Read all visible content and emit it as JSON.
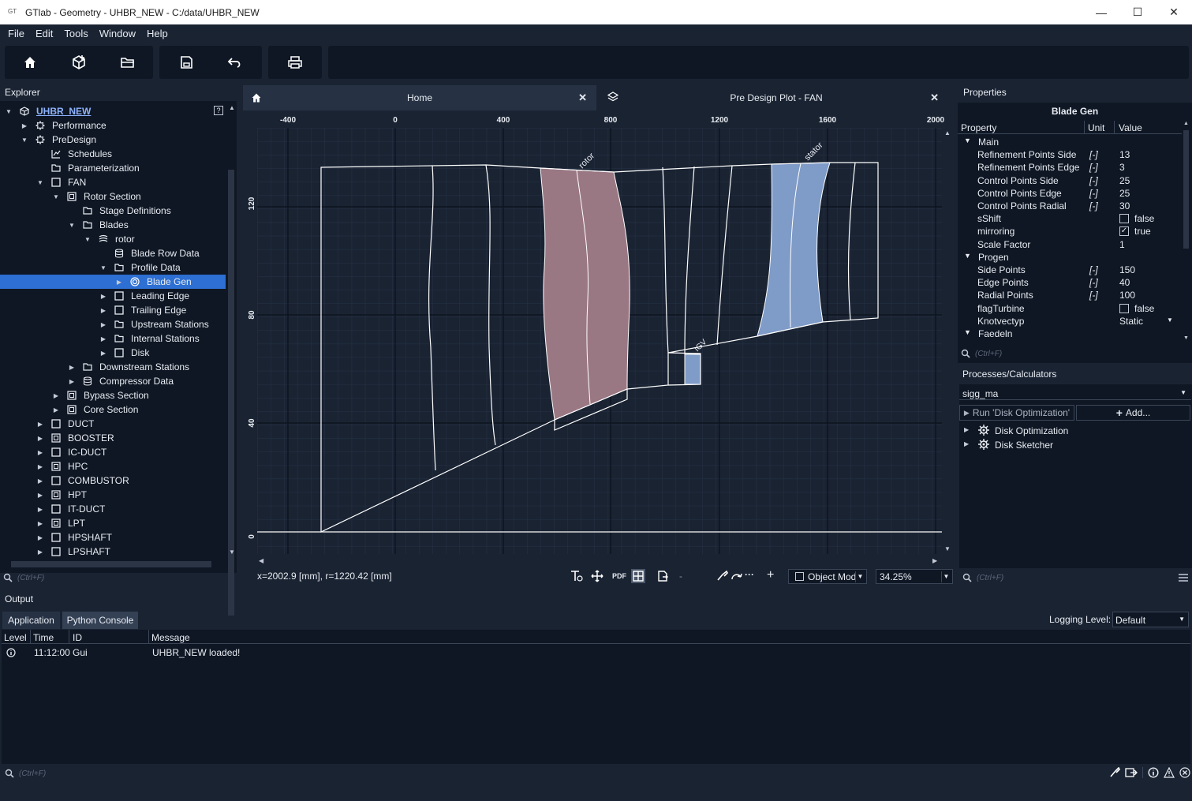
{
  "window": {
    "title": "GTlab - Geometry - UHBR_NEW - C:/data/UHBR_NEW",
    "app_icon": "GT",
    "minimize": "—",
    "maximize": "☐",
    "close": "✕"
  },
  "menu": [
    "File",
    "Edit",
    "Tools",
    "Window",
    "Help"
  ],
  "toolbar": {
    "buttons": [
      "home-icon",
      "new-project-icon",
      "open-folder-icon",
      "save-icon",
      "undo-icon",
      "print-icon"
    ]
  },
  "explorer": {
    "title": "Explorer",
    "help": "?",
    "search_placeholder": "(Ctrl+F)",
    "items": [
      {
        "label": "UHBR_NEW",
        "depth": 0,
        "arrow": "open",
        "icon": "project-icon",
        "highlight": true
      },
      {
        "label": "Performance",
        "depth": 1,
        "arrow": "closed",
        "icon": "gear-icon"
      },
      {
        "label": "PreDesign",
        "depth": 1,
        "arrow": "open",
        "icon": "gear-icon"
      },
      {
        "label": "Schedules",
        "depth": 2,
        "arrow": "none",
        "icon": "chart-icon"
      },
      {
        "label": "Parameterization",
        "depth": 2,
        "arrow": "none",
        "icon": "folder-icon"
      },
      {
        "label": "FAN",
        "depth": 2,
        "arrow": "open",
        "icon": "box-icon"
      },
      {
        "label": "Rotor Section",
        "depth": 3,
        "arrow": "open",
        "icon": "section-icon"
      },
      {
        "label": "Stage Definitions",
        "depth": 4,
        "arrow": "none",
        "icon": "folder-icon"
      },
      {
        "label": "Blades",
        "depth": 4,
        "arrow": "open",
        "icon": "folder-icon"
      },
      {
        "label": "rotor",
        "depth": 5,
        "arrow": "open",
        "icon": "blade-icon"
      },
      {
        "label": "Blade Row Data",
        "depth": 6,
        "arrow": "none",
        "icon": "database-icon"
      },
      {
        "label": "Profile Data",
        "depth": 6,
        "arrow": "open",
        "icon": "folder-icon"
      },
      {
        "label": "Blade Gen",
        "depth": 7,
        "arrow": "closed",
        "icon": "target-icon",
        "selected": true
      },
      {
        "label": "Leading Edge",
        "depth": 6,
        "arrow": "closed",
        "icon": "box-icon"
      },
      {
        "label": "Trailing Edge",
        "depth": 6,
        "arrow": "closed",
        "icon": "box-icon"
      },
      {
        "label": "Upstream Stations",
        "depth": 6,
        "arrow": "closed",
        "icon": "folder-icon"
      },
      {
        "label": "Internal Stations",
        "depth": 6,
        "arrow": "closed",
        "icon": "folder-icon"
      },
      {
        "label": "Disk",
        "depth": 6,
        "arrow": "closed",
        "icon": "box-icon"
      },
      {
        "label": "Downstream Stations",
        "depth": 4,
        "arrow": "closed",
        "icon": "folder-icon"
      },
      {
        "label": "Compressor Data",
        "depth": 4,
        "arrow": "closed",
        "icon": "database-icon"
      },
      {
        "label": "Bypass Section",
        "depth": 3,
        "arrow": "closed",
        "icon": "section-icon"
      },
      {
        "label": "Core Section",
        "depth": 3,
        "arrow": "closed",
        "icon": "section-icon"
      },
      {
        "label": "DUCT",
        "depth": 2,
        "arrow": "closed",
        "icon": "box-icon"
      },
      {
        "label": "BOOSTER",
        "depth": 2,
        "arrow": "closed",
        "icon": "section-icon"
      },
      {
        "label": "IC-DUCT",
        "depth": 2,
        "arrow": "closed",
        "icon": "box-icon"
      },
      {
        "label": "HPC",
        "depth": 2,
        "arrow": "closed",
        "icon": "section-icon"
      },
      {
        "label": "COMBUSTOR",
        "depth": 2,
        "arrow": "closed",
        "icon": "box-icon"
      },
      {
        "label": "HPT",
        "depth": 2,
        "arrow": "closed",
        "icon": "section-icon"
      },
      {
        "label": "IT-DUCT",
        "depth": 2,
        "arrow": "closed",
        "icon": "box-icon"
      },
      {
        "label": "LPT",
        "depth": 2,
        "arrow": "closed",
        "icon": "section-icon"
      },
      {
        "label": "HPSHAFT",
        "depth": 2,
        "arrow": "closed",
        "icon": "box-icon"
      },
      {
        "label": "LPSHAFT",
        "depth": 2,
        "arrow": "closed",
        "icon": "box-icon"
      }
    ]
  },
  "tabs": [
    {
      "label": "Home",
      "icon": "home-icon",
      "close": "✕"
    },
    {
      "label": "Pre Design Plot - FAN",
      "icon": "layers-icon",
      "close": "✕",
      "active": true
    }
  ],
  "plot": {
    "x_ticks": [
      "-400",
      "0",
      "400",
      "800",
      "1200",
      "1600",
      "2000"
    ],
    "y_ticks": [
      "120",
      "80",
      "40",
      "0"
    ],
    "labels": {
      "rotor": "rotor",
      "stator": "stator",
      "igv": "IGV"
    },
    "rotor_color": "#9a7883",
    "stator_color": "#7f9bc7"
  },
  "status": {
    "coords": "x=2002.9 [mm], r=1220.42 [mm]",
    "mode": "Object Mod",
    "zoom": "34.25%",
    "pdf": "PDF",
    "minus": "-",
    "plus": "+"
  },
  "properties": {
    "title": "Properties",
    "object": "Blade Gen",
    "columns": [
      "Property",
      "Unit",
      "Value"
    ],
    "search_placeholder": "(Ctrl+F)",
    "rows": [
      {
        "group": "Main"
      },
      {
        "name": "Refinement Points Side",
        "unit": "[-]",
        "value": "13"
      },
      {
        "name": "Refinement Points Edge",
        "unit": "[-]",
        "value": "3"
      },
      {
        "name": "Control Points Side",
        "unit": "[-]",
        "value": "25"
      },
      {
        "name": "Control Points Edge",
        "unit": "[-]",
        "value": "25"
      },
      {
        "name": "Control Points Radial",
        "unit": "[-]",
        "value": "30"
      },
      {
        "name": "sShift",
        "unit": "",
        "value": "false",
        "check": false
      },
      {
        "name": "mirroring",
        "unit": "",
        "value": "true",
        "check": true
      },
      {
        "name": "Scale Factor",
        "unit": "",
        "value": "1"
      },
      {
        "group": "Progen"
      },
      {
        "name": "Side Points",
        "unit": "[-]",
        "value": "150"
      },
      {
        "name": "Edge Points",
        "unit": "[-]",
        "value": "40"
      },
      {
        "name": "Radial Points",
        "unit": "[-]",
        "value": "100"
      },
      {
        "name": "flagTurbine",
        "unit": "",
        "value": "false",
        "check": false
      },
      {
        "name": "Knotvectyp",
        "unit": "",
        "value": "Static",
        "dropdown": true
      },
      {
        "group": "Faedeln"
      }
    ]
  },
  "processes": {
    "title": "Processes/Calculators",
    "selected": "sigg_ma",
    "run_button": "Run 'Disk Optimization'",
    "add_button": "Add...",
    "items": [
      "Disk Optimization",
      "Disk Sketcher"
    ],
    "search_placeholder": "(Ctrl+F)"
  },
  "output": {
    "title": "Output",
    "tabs": [
      "Application",
      "Python Console"
    ],
    "logging_label": "Logging Level:",
    "logging_value": "Default",
    "columns": [
      "Level",
      "Time",
      "ID",
      "Message"
    ],
    "rows": [
      {
        "level": "info-icon",
        "time": "11:12:00",
        "id": "Gui",
        "message": "UHBR_NEW loaded!"
      }
    ],
    "search_placeholder": "(Ctrl+F)"
  }
}
